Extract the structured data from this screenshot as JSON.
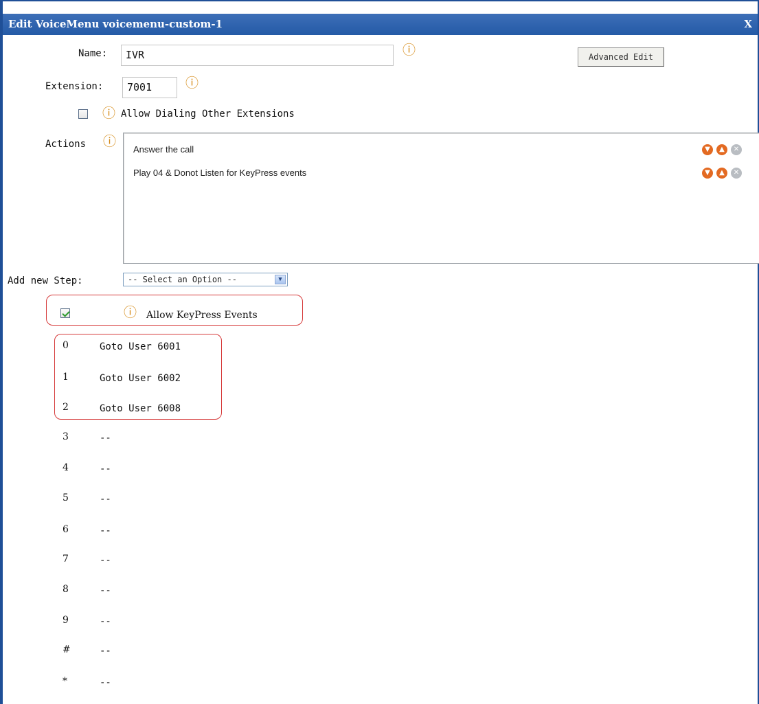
{
  "window": {
    "title": "Edit VoiceMenu voicemenu-custom-1",
    "close_label": "X"
  },
  "form": {
    "name_label": "Name:",
    "name_value": "IVR",
    "extension_label": "Extension:",
    "extension_value": "7001",
    "advanced_edit_label": "Advanced Edit",
    "allow_dialing_label": "Allow Dialing Other Extensions",
    "allow_dialing_checked": false,
    "actions_label": "Actions",
    "add_step_label": "Add new Step:",
    "add_step_selected": "-- Select an Option --",
    "allow_keypress_label": "Allow KeyPress Events",
    "allow_keypress_checked": true
  },
  "actions": [
    {
      "text": "Answer the call"
    },
    {
      "text": "Play 04 & Donot Listen for KeyPress events"
    }
  ],
  "keypress": [
    {
      "key": "0",
      "value": "Goto User 6001"
    },
    {
      "key": "1",
      "value": "Goto User 6002"
    },
    {
      "key": "2",
      "value": "Goto User 6008"
    },
    {
      "key": "3",
      "value": "--"
    },
    {
      "key": "4",
      "value": "--"
    },
    {
      "key": "5",
      "value": "--"
    },
    {
      "key": "6",
      "value": "--"
    },
    {
      "key": "7",
      "value": "--"
    },
    {
      "key": "8",
      "value": "--"
    },
    {
      "key": "9",
      "value": "--"
    },
    {
      "key": "#",
      "value": "--"
    },
    {
      "key": "*",
      "value": "--"
    }
  ],
  "icons": {
    "info": "info-icon",
    "move_down": "move-down-icon",
    "move_up": "move-up-icon",
    "delete": "delete-icon"
  },
  "colors": {
    "titlebar": "#245aa6",
    "info_icon": "#d58a16",
    "action_arrow": "#e36a22",
    "highlight_box": "#d63a3a"
  }
}
